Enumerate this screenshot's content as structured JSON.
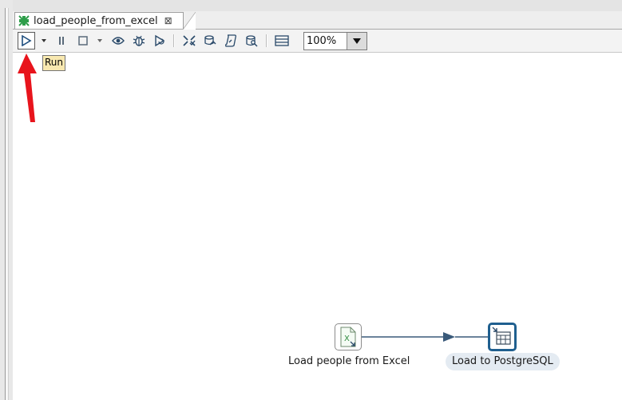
{
  "editor": {
    "tab_title": "load_people_from_excel",
    "tab_icon": "transformation-icon",
    "close_icon": "close-icon"
  },
  "toolbar": {
    "buttons": [
      {
        "name": "run",
        "icon": "run-icon"
      },
      {
        "name": "run-options",
        "icon": "chevron-down-icon"
      },
      {
        "name": "pause",
        "icon": "pause-icon"
      },
      {
        "name": "stop",
        "icon": "stop-icon"
      },
      {
        "name": "stop-options",
        "icon": "chevron-down-icon"
      },
      {
        "name": "preview",
        "icon": "eye-icon"
      },
      {
        "name": "debug",
        "icon": "bug-icon"
      },
      {
        "name": "replay",
        "icon": "replay-icon"
      },
      {
        "name": "verify",
        "icon": "verify-icon"
      },
      {
        "name": "impact",
        "icon": "impact-icon"
      },
      {
        "name": "sql",
        "icon": "script-icon"
      },
      {
        "name": "explore-db",
        "icon": "database-search-icon"
      },
      {
        "name": "show-results",
        "icon": "results-panel-icon"
      }
    ],
    "zoom_value": "100%"
  },
  "tooltip": {
    "text": "Run"
  },
  "canvas": {
    "steps": [
      {
        "label": "Load people from Excel",
        "icon": "excel-input-icon"
      },
      {
        "label": "Load to PostgreSQL",
        "icon": "table-output-icon"
      }
    ],
    "hop_color": "#3a5a7a"
  },
  "annotation": {
    "arrow_color": "#e8141c"
  }
}
